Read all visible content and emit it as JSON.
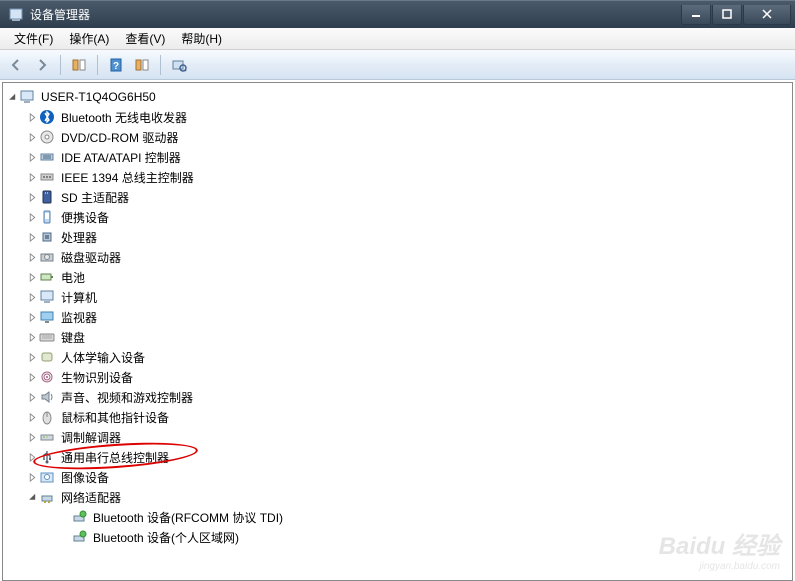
{
  "window": {
    "title": "设备管理器"
  },
  "menu": {
    "file": "文件(F)",
    "action": "操作(A)",
    "view": "查看(V)",
    "help": "帮助(H)"
  },
  "tree": {
    "root": "USER-T1Q4OG6H50",
    "items": [
      {
        "label": "Bluetooth 无线电收发器",
        "icon": "bluetooth"
      },
      {
        "label": "DVD/CD-ROM 驱动器",
        "icon": "dvd"
      },
      {
        "label": "IDE ATA/ATAPI 控制器",
        "icon": "ide"
      },
      {
        "label": "IEEE 1394 总线主控制器",
        "icon": "ieee"
      },
      {
        "label": "SD 主适配器",
        "icon": "sd"
      },
      {
        "label": "便携设备",
        "icon": "portable"
      },
      {
        "label": "处理器",
        "icon": "cpu"
      },
      {
        "label": "磁盘驱动器",
        "icon": "disk"
      },
      {
        "label": "电池",
        "icon": "battery"
      },
      {
        "label": "计算机",
        "icon": "computer"
      },
      {
        "label": "监视器",
        "icon": "monitor"
      },
      {
        "label": "键盘",
        "icon": "keyboard"
      },
      {
        "label": "人体学输入设备",
        "icon": "hid"
      },
      {
        "label": "生物识别设备",
        "icon": "biometric"
      },
      {
        "label": "声音、视频和游戏控制器",
        "icon": "sound"
      },
      {
        "label": "鼠标和其他指针设备",
        "icon": "mouse"
      },
      {
        "label": "调制解调器",
        "icon": "modem"
      },
      {
        "label": "通用串行总线控制器",
        "icon": "usb",
        "highlighted": true
      },
      {
        "label": "图像设备",
        "icon": "image"
      },
      {
        "label": "网络适配器",
        "icon": "network",
        "expanded": true,
        "children": [
          {
            "label": "Bluetooth 设备(RFCOMM 协议 TDI)",
            "icon": "netadapter"
          },
          {
            "label": "Bluetooth 设备(个人区域网)",
            "icon": "netadapter"
          }
        ]
      }
    ]
  },
  "watermark": {
    "brand": "Baidu 经验",
    "url": "jingyan.baidu.com"
  }
}
